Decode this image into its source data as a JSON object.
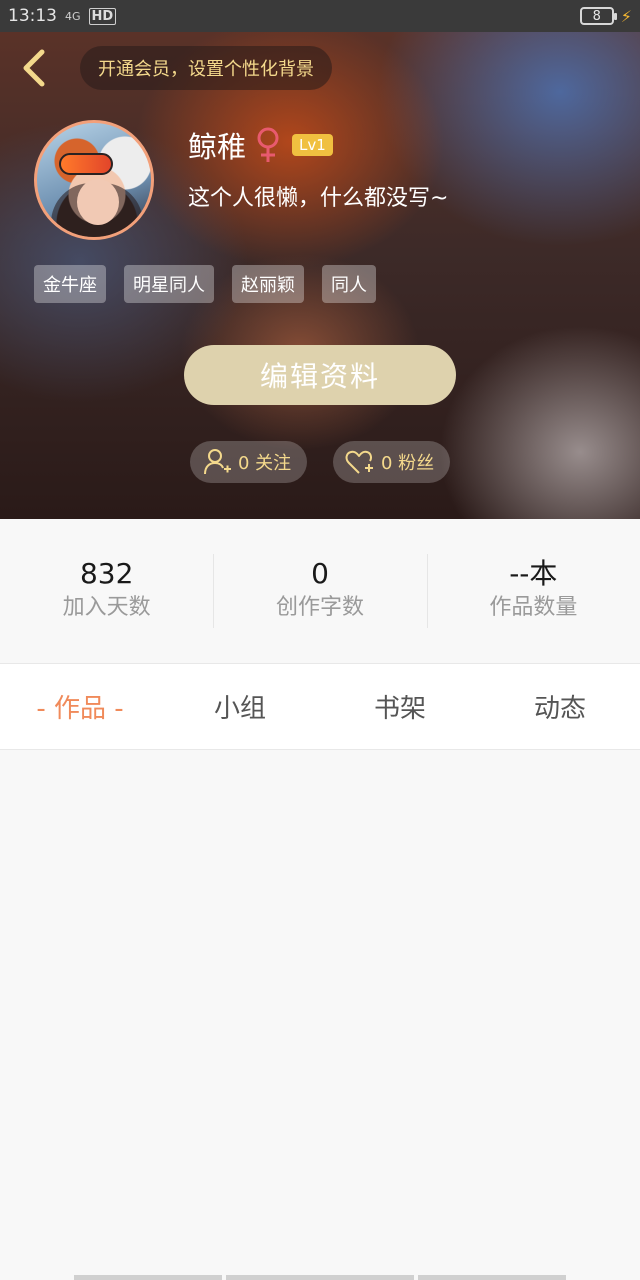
{
  "status_bar": {
    "time": "13:13",
    "signal": "4G",
    "hd": "HD",
    "battery": "8"
  },
  "header": {
    "vip_banner": "开通会员，设置个性化背景",
    "nickname": "鲸稚",
    "gender_symbol": "♀",
    "level": "Lv1",
    "signature": "这个人很懒，什么都没写~",
    "tags": [
      "金牛座",
      "明星同人",
      "赵丽颖",
      "同人"
    ],
    "edit_button": "编辑资料",
    "follow_label": "0 关注",
    "fans_label": "0 粉丝"
  },
  "stats": [
    {
      "value": "832",
      "label": "加入天数"
    },
    {
      "value": "0",
      "label": "创作字数"
    },
    {
      "value": "--本",
      "label": "作品数量"
    }
  ],
  "tabs": [
    {
      "label": "作品",
      "active": true
    },
    {
      "label": "小组",
      "active": false
    },
    {
      "label": "书架",
      "active": false
    },
    {
      "label": "动态",
      "active": false
    }
  ],
  "colors": {
    "accent": "#f08a5a",
    "gold": "#f4d98c",
    "edit_button_bg": "#ded2ad",
    "level_badge": "#f0c040"
  },
  "icons": {
    "back": "chevron-left-icon",
    "gender": "female-icon",
    "follow": "add-user-icon",
    "fans": "heart-plus-icon"
  }
}
